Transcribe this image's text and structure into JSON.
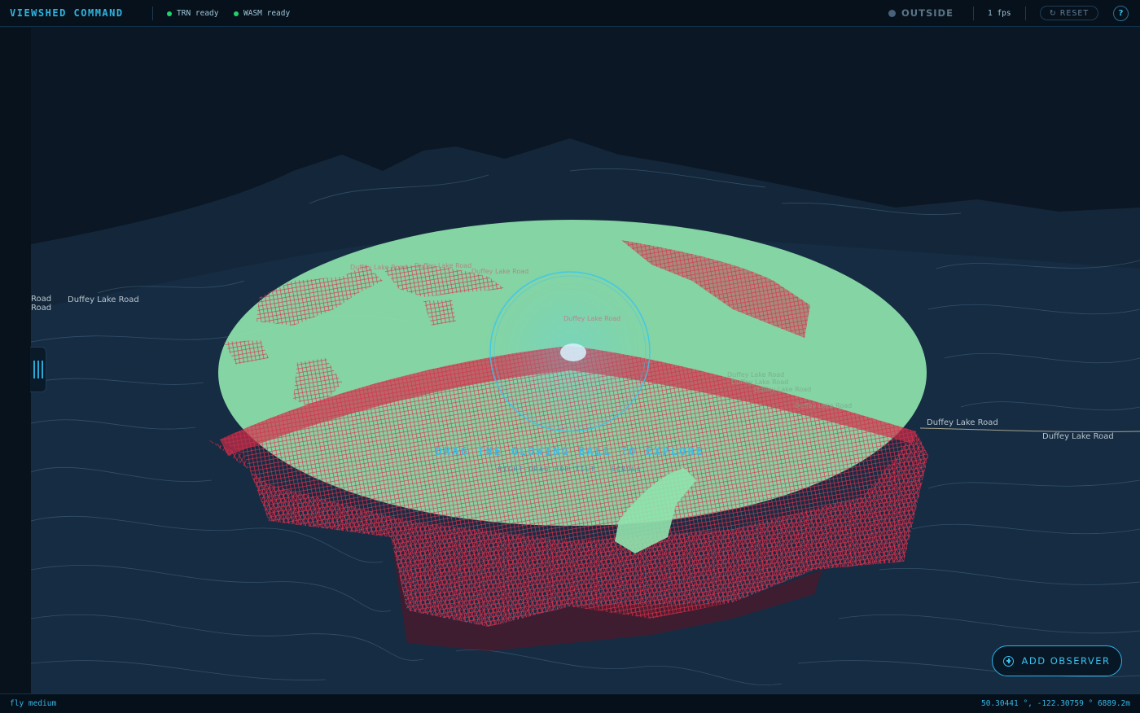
{
  "app": {
    "title": "VIEWSHED COMMAND"
  },
  "status": {
    "trn": "TRN ready",
    "wasm": "WASM ready",
    "ready_color": "#21d36b"
  },
  "header": {
    "mode_state": "OUTSIDE",
    "fps": "1 fps",
    "reset_label": "RESET",
    "reset_icon": "refresh-icon",
    "help_label": "?"
  },
  "map": {
    "road_labels": [
      "Road",
      "Duffey Lake Road",
      "Road",
      "Duffey Lake Road",
      "Duffey Lake Road",
      "Duffey Lake Road",
      "Duffey Lake Road",
      "Duffey Lake Road",
      "Duffey Lake Road",
      "Duffey Lake Road",
      "Duffey Lake Road",
      "Duffey Lake Road",
      "Duffey Lake Road"
    ],
    "visible_color": "#8fe3ad",
    "hidden_color": "#e0324f",
    "hint": "DRAG THE GLOWING BALL TO EXPLORE",
    "hint_sub": "RIGHT-DRAG FOR TILT · SCROLL"
  },
  "actions": {
    "add_observer_label": "ADD OBSERVER",
    "add_icon": "plus-circle-icon"
  },
  "footer": {
    "camera_mode": "fly medium",
    "coordinates": "50.30441 °, -122.30759 ° 6889.2m"
  }
}
